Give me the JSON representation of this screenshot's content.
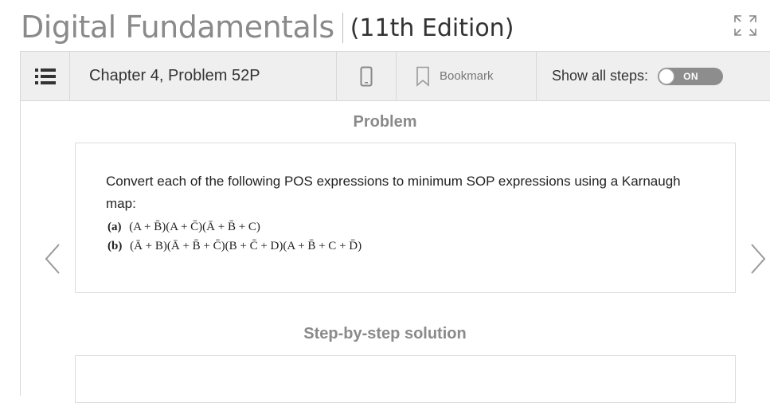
{
  "book": {
    "title": "Digital Fundamentals",
    "edition": "(11th Edition)"
  },
  "toolbar": {
    "menu_icon": "list-icon",
    "chapter_label": "Chapter 4, Problem 52P",
    "mobile_icon": "smartphone-icon",
    "bookmark_label": "Bookmark",
    "show_steps_label": "Show all steps:",
    "toggle_state": "ON",
    "expand_icon": "expand-icon"
  },
  "problem": {
    "heading": "Problem",
    "text": "Convert each of the following POS expressions to minimum SOP expressions using a Karnaugh map:",
    "expressions": [
      {
        "tag": "(a)",
        "expression": "(A + B̄)(A + C̄)(Ā + B̄ + C)"
      },
      {
        "tag": "(b)",
        "expression": "(Ā + B)(Ā + B̄ + C̄)(B + C̄ + D)(A + B̄ + C + D̄)"
      }
    ]
  },
  "solution": {
    "heading": "Step-by-step solution"
  },
  "navigation": {
    "prev_icon": "chevron-left-icon",
    "next_icon": "chevron-right-icon"
  },
  "colors": {
    "toolbar_bg": "#efefef",
    "title_gray": "#8a8a8a",
    "toggle_bg": "#8d8d8d",
    "border": "#d8d8d8"
  }
}
